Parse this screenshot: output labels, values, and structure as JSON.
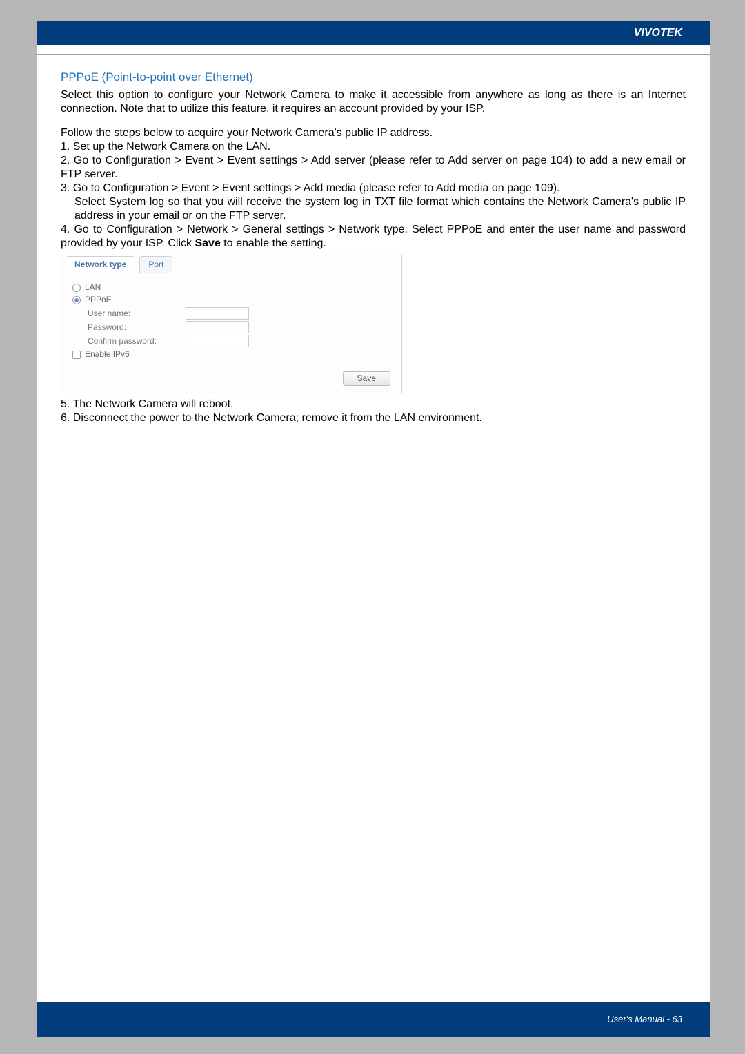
{
  "header": {
    "brand": "VIVOTEK"
  },
  "section": {
    "title": "PPPoE (Point-to-point over Ethernet)"
  },
  "paragraphs": {
    "intro": "Select this option to configure your Network Camera to make it accessible from anywhere as long as there is an Internet connection. Note that to utilize this feature, it requires an account provided by your ISP.",
    "follow": "Follow the steps below to acquire your Network Camera's public IP address."
  },
  "steps": {
    "s1": "1. Set up the Network Camera on the LAN.",
    "s2": "2. Go to Configuration > Event > Event settings > Add server (please refer to Add server on page 104) to add a new email or FTP server.",
    "s3": "3. Go to Configuration > Event > Event settings > Add media (please refer to Add media on page 109).",
    "s3b": "Select System log so that you will receive the system log in TXT file format which contains the Network Camera's public IP address in your email or on the FTP server.",
    "s4a": "4. Go to Configuration > Network > General settings > Network type. Select PPPoE and enter the user name and password provided by your ISP. Click ",
    "s4b": "Save",
    "s4c": " to enable the setting.",
    "s5": "5. The Network Camera will reboot.",
    "s6": "6. Disconnect the power to the Network Camera; remove it from the LAN environment."
  },
  "panel": {
    "tabs": {
      "network_type": "Network type",
      "port": "Port"
    },
    "radio_lan": "LAN",
    "radio_pppoe": "PPPoE",
    "username_label": "User name:",
    "password_label": "Password:",
    "confirm_label": "Confirm password:",
    "enable_ipv6": "Enable IPv6",
    "save": "Save"
  },
  "footer": {
    "text": "User's Manual - 63"
  }
}
